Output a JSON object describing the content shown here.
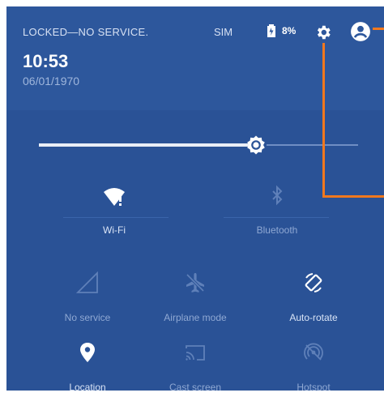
{
  "status_bar": {
    "carrier_text": "LOCKED—NO SERVICE.",
    "sim_text": "SIM",
    "battery": "8%",
    "settings_icon": "gear-icon",
    "account_icon": "account-circle-icon"
  },
  "clock": {
    "time": "10:53",
    "date": "06/01/1970"
  },
  "brightness": {
    "level": 0.68
  },
  "tiles": [
    {
      "label": "Wi-Fi",
      "icon": "wifi-alert-icon",
      "state": "on"
    },
    {
      "label": "Bluetooth",
      "icon": "bluetooth-icon",
      "state": "off"
    },
    {
      "label": "No service",
      "icon": "signal-icon",
      "state": "off"
    },
    {
      "label": "Airplane mode",
      "icon": "airplane-icon",
      "state": "off"
    },
    {
      "label": "Auto-rotate",
      "icon": "auto-rotate-icon",
      "state": "on"
    },
    {
      "label": "Location",
      "icon": "location-pin-icon",
      "state": "on"
    },
    {
      "label": "Cast screen",
      "icon": "cast-icon",
      "state": "off"
    },
    {
      "label": "Hotspot",
      "icon": "hotspot-icon",
      "state": "off"
    }
  ],
  "colors": {
    "panel": "#2a5296",
    "callout": "#f0781e"
  }
}
